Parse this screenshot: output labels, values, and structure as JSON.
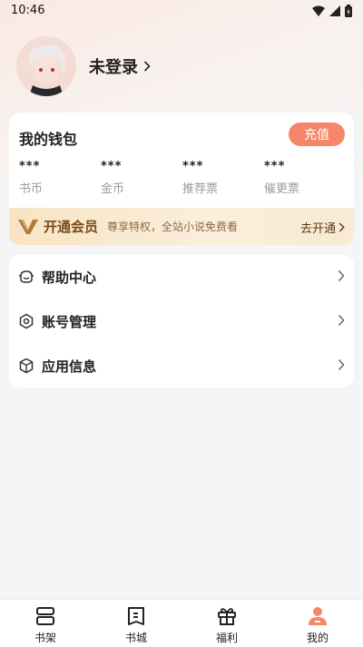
{
  "status_bar": {
    "time": "10:46"
  },
  "profile": {
    "login_text": "未登录"
  },
  "wallet": {
    "title": "我的钱包",
    "recharge_label": "充值",
    "stats": [
      {
        "value": "***",
        "label": "书币"
      },
      {
        "value": "***",
        "label": "金币"
      },
      {
        "value": "***",
        "label": "推荐票"
      },
      {
        "value": "***",
        "label": "催更票"
      }
    ]
  },
  "vip": {
    "title": "开通会员",
    "subtitle": "尊享特权，全站小说免费看",
    "action": "去开通"
  },
  "menu": [
    {
      "label": "帮助中心",
      "icon": "help-center-icon"
    },
    {
      "label": "账号管理",
      "icon": "account-management-icon"
    },
    {
      "label": "应用信息",
      "icon": "app-info-icon"
    }
  ],
  "tabs": [
    {
      "label": "书架",
      "icon": "bookshelf-icon"
    },
    {
      "label": "书城",
      "icon": "bookstore-icon"
    },
    {
      "label": "福利",
      "icon": "gift-icon"
    },
    {
      "label": "我的",
      "icon": "profile-icon"
    }
  ],
  "colors": {
    "accent": "#f6866a",
    "vip_text": "#7a4a17",
    "active_tab": "#f6866a"
  }
}
